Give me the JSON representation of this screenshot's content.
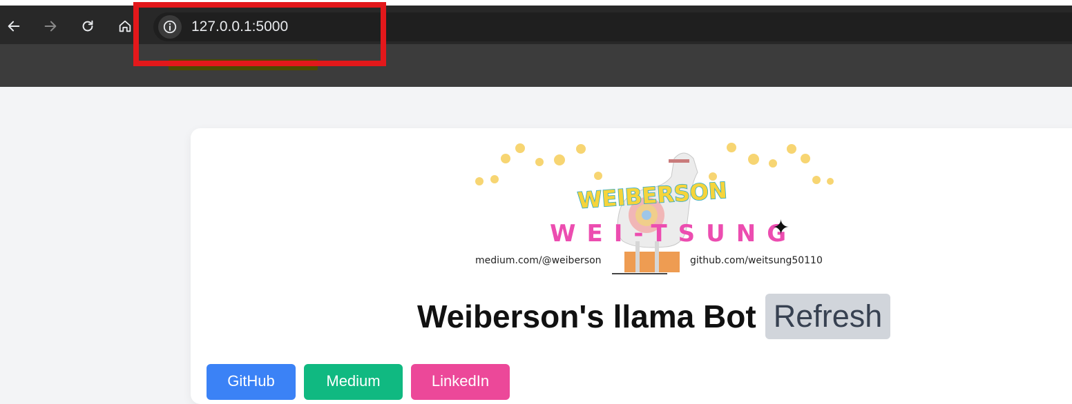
{
  "browser": {
    "url": "127.0.0.1:5000",
    "nav": {
      "back_icon": "arrow-left-icon",
      "forward_icon": "arrow-right-icon",
      "reload_icon": "reload-icon",
      "home_icon": "home-icon",
      "site_info_icon": "info-icon"
    }
  },
  "annotation": {
    "color": "#e3181b"
  },
  "logo": {
    "line1": "WEIBERSON",
    "line2": "WEI-TSUNG",
    "medium": "medium.com/@weiberson",
    "github": "github.com/weitsung50110",
    "sparkle": "✦"
  },
  "page": {
    "title": "Weiberson's llama Bot",
    "refresh_label": "Refresh",
    "links": {
      "github": "GitHub",
      "medium": "Medium",
      "linkedin": "LinkedIn"
    }
  },
  "colors": {
    "github": "#3b82f6",
    "medium": "#10b981",
    "linkedin": "#ec4899",
    "refresh": "#d1d5db"
  }
}
